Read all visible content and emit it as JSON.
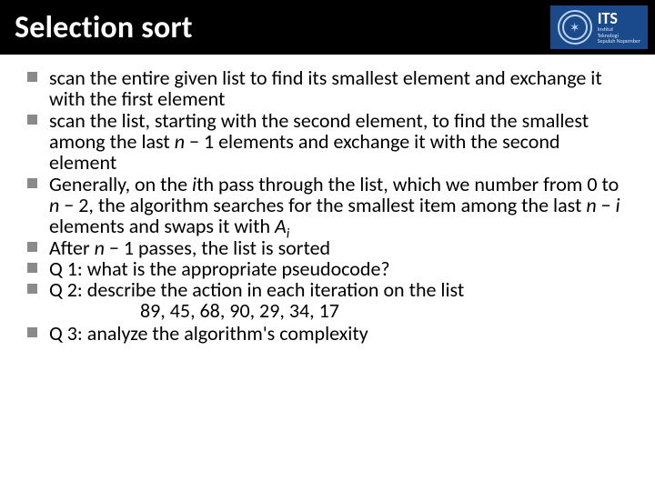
{
  "header": {
    "title": "Selection sort",
    "logo_acronym": "ITS",
    "logo_sub1": "Institut",
    "logo_sub2": "Teknologi",
    "logo_sub3": "Sepuluh Nopember"
  },
  "bullets": {
    "b1": "scan the entire given list to find its smallest element and exchange it with the first element",
    "b2_a": "scan the list, starting with the second element, to find the smallest among the last ",
    "b2_n": "n",
    "b2_b": " − 1 elements and exchange it with the second element",
    "b3_a": "Generally, on the ",
    "b3_i1": "i",
    "b3_b": "th pass through the list, which we number from 0 to ",
    "b3_n1": "n",
    "b3_c": " − 2, the algorithm searches for the smallest item among the last ",
    "b3_n2": "n",
    "b3_d": " − ",
    "b3_i2": "i",
    "b3_e": " elements and swaps it with ",
    "b3_A": "A",
    "b3_sub": "i",
    "b4_a": "After ",
    "b4_n": "n",
    "b4_b": " − 1 passes, the list is sorted",
    "b5": "Q 1: what is the appropriate pseudocode?",
    "b6": "Q 2: describe the action in each iteration on the list",
    "b6_data": "89, 45, 68, 90, 29, 34, 17",
    "b7": "Q 3: analyze the algorithm's complexity"
  }
}
